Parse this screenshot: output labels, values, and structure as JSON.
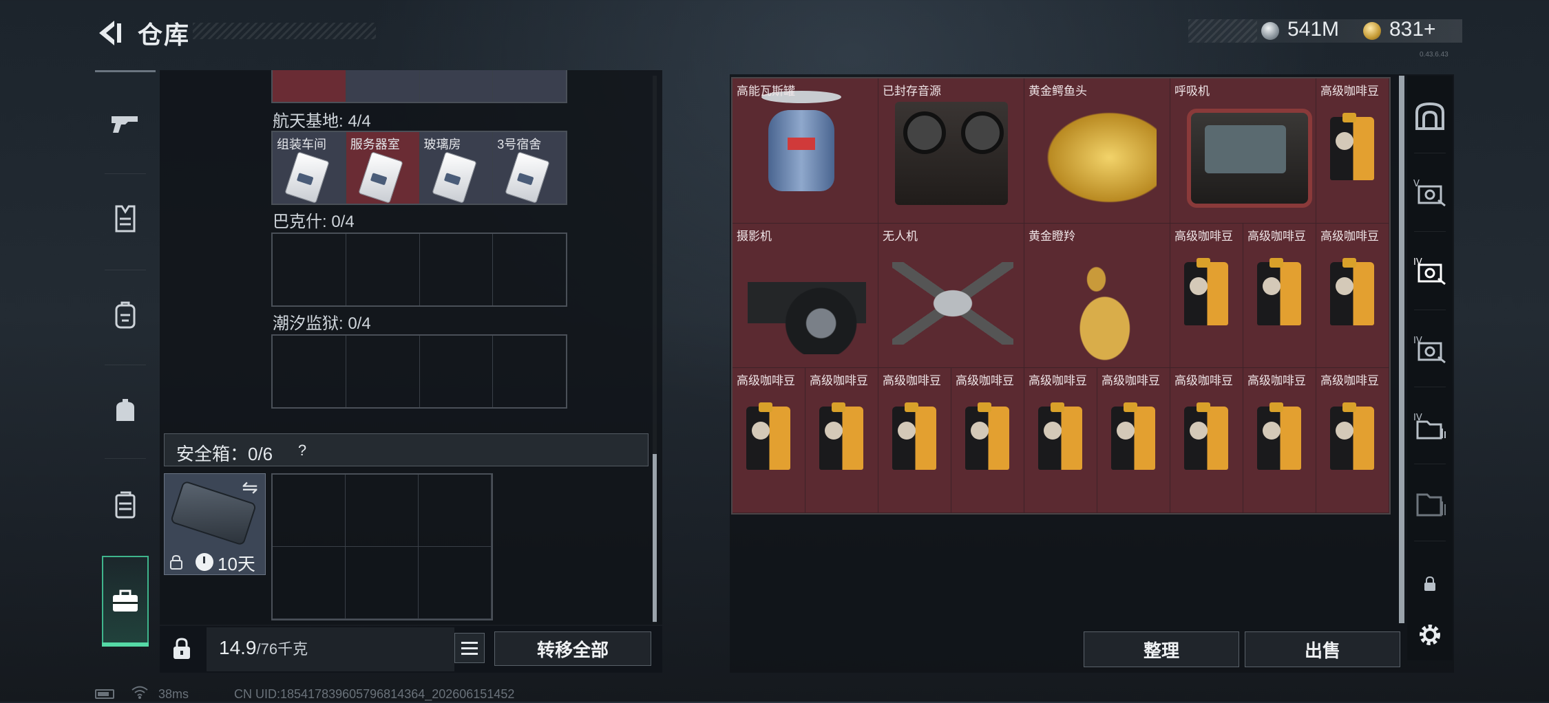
{
  "header": {
    "title": "仓库",
    "currency": {
      "silver": "541M",
      "gold": "831+"
    },
    "version": "0.43.6.43"
  },
  "sidebar": {
    "items": [
      "gun-icon",
      "armor-icon",
      "backpack-icon",
      "bag-icon",
      "rig-icon",
      "safebox-icon"
    ],
    "active": "safebox-icon"
  },
  "left_panel": {
    "groups": [
      {
        "label": "航天基地: 4/4",
        "slots": [
          {
            "label": "组装车间",
            "red": false
          },
          {
            "label": "服务器室",
            "red": true
          },
          {
            "label": "玻璃房",
            "red": false
          },
          {
            "label": "3号宿舍",
            "red": false
          }
        ]
      },
      {
        "label": "巴克什: 0/4"
      },
      {
        "label": "潮汐监狱: 0/4"
      }
    ],
    "safebox": {
      "label": "安全箱：0/6",
      "help": "?",
      "duration": "10天"
    },
    "weight": {
      "current": "14.9",
      "max": "/76千克"
    },
    "transfer_all": "转移全部"
  },
  "storage_items": [
    {
      "name": "高能瓦斯罐",
      "art": "gas-tank",
      "span": 2
    },
    {
      "name": "已封存音源",
      "art": "tape",
      "span": 2
    },
    {
      "name": "黄金鳄鱼头",
      "art": "croc",
      "span": 2
    },
    {
      "name": "呼吸机",
      "art": "respirator",
      "span": 2
    },
    {
      "name": "高级咖啡豆",
      "art": "coffee",
      "span": 1
    },
    {
      "name": "摄影机",
      "art": "camera",
      "span": 2
    },
    {
      "name": "无人机",
      "art": "drone",
      "span": 2
    },
    {
      "name": "黄金瞪羚",
      "art": "deer",
      "span": 2
    },
    {
      "name": "高级咖啡豆",
      "art": "coffee",
      "span": 1
    },
    {
      "name": "高级咖啡豆",
      "art": "coffee",
      "span": 1
    },
    {
      "name": "高级咖啡豆",
      "art": "coffee",
      "span": 1
    },
    {
      "name": "高级咖啡豆",
      "art": "coffee",
      "span": 1
    },
    {
      "name": "高级咖啡豆",
      "art": "coffee",
      "span": 1
    },
    {
      "name": "高级咖啡豆",
      "art": "coffee",
      "span": 1
    },
    {
      "name": "高级咖啡豆",
      "art": "coffee",
      "span": 1
    },
    {
      "name": "高级咖啡豆",
      "art": "coffee",
      "span": 1
    },
    {
      "name": "高级咖啡豆",
      "art": "coffee",
      "span": 1
    },
    {
      "name": "高级咖啡豆",
      "art": "coffee",
      "span": 1
    },
    {
      "name": "高级咖啡豆",
      "art": "coffee",
      "span": 1
    },
    {
      "name": "高级咖啡豆",
      "art": "coffee",
      "span": 1
    }
  ],
  "right_panel": {
    "tabs": [
      "vault-icon",
      "case-v-icon",
      "case-iv-icon",
      "case-iv-2-icon",
      "folder-iv-icon",
      "folder-icon",
      "lock-icon"
    ],
    "active_tab": "case-iv-icon",
    "sort": "整理",
    "sell": "出售"
  },
  "status": {
    "ping": "38ms",
    "uid": "CN UID:185417839605796814364_202606151452"
  },
  "colors": {
    "accent_green": "#3fb58c",
    "item_bg": "#5b2a31"
  }
}
